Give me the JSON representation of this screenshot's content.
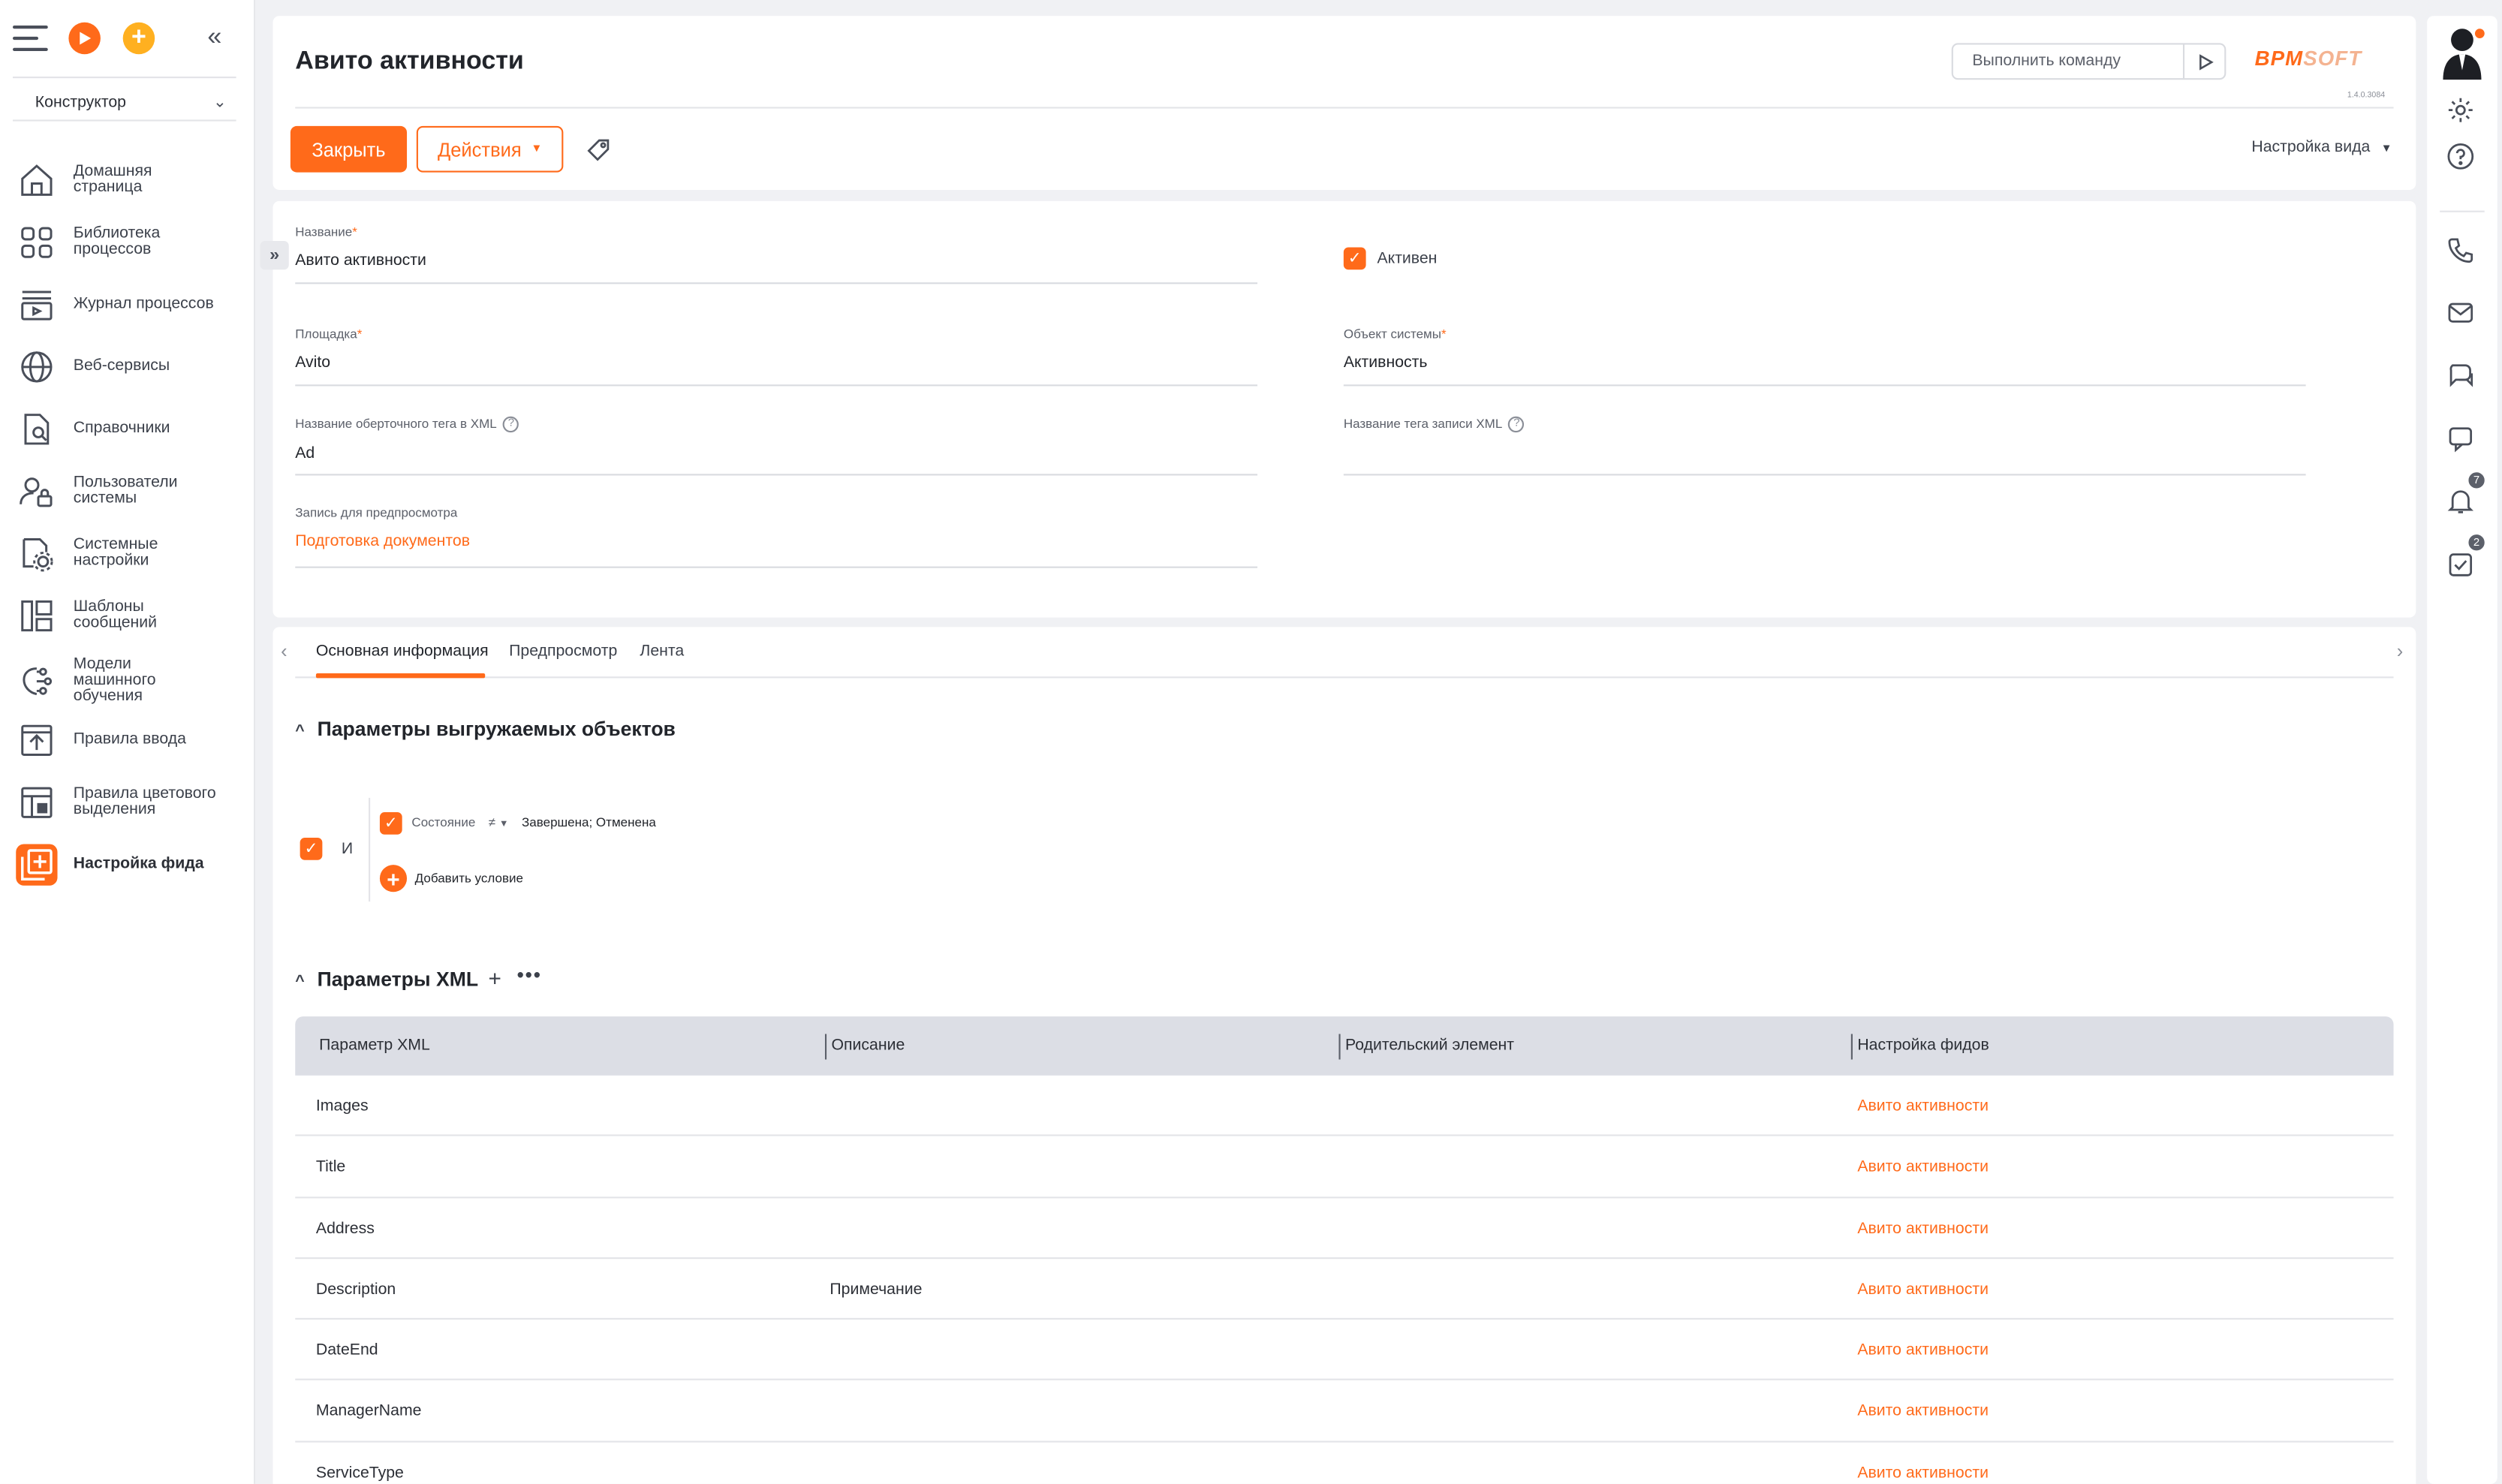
{
  "sidebar": {
    "selector": "Конструктор",
    "items": [
      {
        "label": "Домашняя страница",
        "icon": "home-icon"
      },
      {
        "label": "Библиотека процессов",
        "icon": "process-library-icon"
      },
      {
        "label": "Журнал процессов",
        "icon": "process-log-icon"
      },
      {
        "label": "Веб-сервисы",
        "icon": "globe-icon"
      },
      {
        "label": "Справочники",
        "icon": "lookups-icon"
      },
      {
        "label": "Пользователи системы",
        "icon": "users-lock-icon"
      },
      {
        "label": "Системные настройки",
        "icon": "settings-doc-icon"
      },
      {
        "label": "Шаблоны сообщений",
        "icon": "templates-icon"
      },
      {
        "label": "Модели машинного обучения",
        "icon": "ml-brain-icon"
      },
      {
        "label": "Правила ввода",
        "icon": "input-rules-icon"
      },
      {
        "label": "Правила цветового выделения",
        "icon": "color-rules-icon"
      },
      {
        "label": "Настройка фида",
        "icon": "feed-settings-icon"
      }
    ]
  },
  "header": {
    "title": "Авито активности",
    "command_placeholder": "Выполнить команду",
    "logo_part1": "BPM",
    "logo_part2": "SOFT",
    "version": "1.4.0.3084",
    "close_label": "Закрыть",
    "actions_label": "Действия",
    "view_settings_label": "Настройка вида"
  },
  "form": {
    "name_label": "Название",
    "name_value": "Авито активности",
    "active_label": "Активен",
    "active_checked": true,
    "platform_label": "Площадка",
    "platform_value": "Avito",
    "object_label": "Объект системы",
    "object_value": "Активность",
    "wrapper_tag_label": "Название оберточного тега в XML",
    "wrapper_tag_value": "Ad",
    "record_tag_label": "Название тега записи XML",
    "record_tag_value": "",
    "preview_label": "Запись для предпросмотра",
    "preview_value": "Подготовка документов"
  },
  "tabs": [
    {
      "label": "Основная информация",
      "active": true
    },
    {
      "label": "Предпросмотр",
      "active": false
    },
    {
      "label": "Лента",
      "active": false
    }
  ],
  "filters": {
    "section_title": "Параметры выгружаемых объектов",
    "group_operator": "И",
    "condition_field": "Состояние",
    "condition_op": "≠",
    "condition_value": "Завершена; Отменена",
    "add_condition_label": "Добавить условие"
  },
  "xml": {
    "section_title": "Параметры XML",
    "columns": [
      "Параметр XML",
      "Описание",
      "Родительский элемент",
      "Настройка фидов"
    ],
    "rows": [
      {
        "param": "Images",
        "description": "",
        "parent": "",
        "feed": "Авито активности"
      },
      {
        "param": "Title",
        "description": "",
        "parent": "",
        "feed": "Авито активности"
      },
      {
        "param": "Address",
        "description": "",
        "parent": "",
        "feed": "Авито активности"
      },
      {
        "param": "Description",
        "description": "Примечание",
        "parent": "",
        "feed": "Авито активности"
      },
      {
        "param": "DateEnd",
        "description": "",
        "parent": "",
        "feed": "Авито активности"
      },
      {
        "param": "ManagerName",
        "description": "",
        "parent": "",
        "feed": "Авито активности"
      },
      {
        "param": "ServiceType",
        "description": "",
        "parent": "",
        "feed": "Авито активности"
      }
    ]
  },
  "rightbar": {
    "notifications_count": "7",
    "tasks_count": "2"
  },
  "colors": {
    "accent": "#ff6a1a",
    "table_header": "#dcdee5"
  }
}
